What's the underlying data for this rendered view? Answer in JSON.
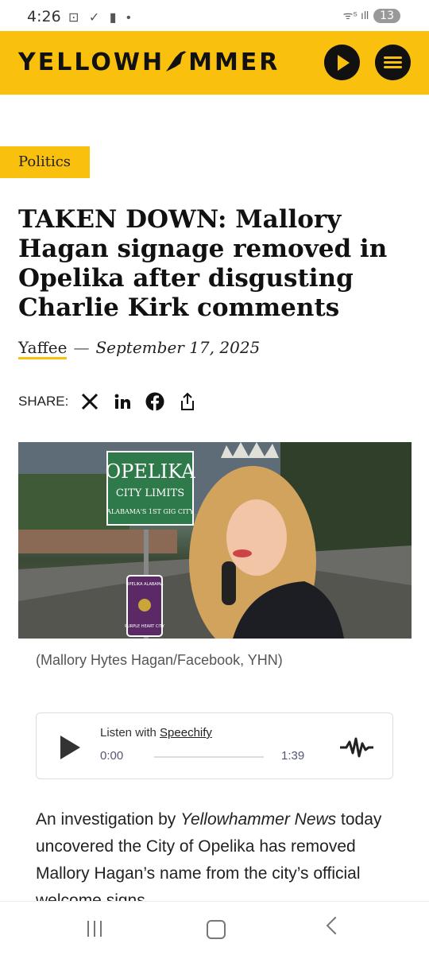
{
  "status_bar": {
    "time": "4:26",
    "icons": "⊡ ✓ ▮ •",
    "signal": "ᯤ⁵ ıll",
    "battery": "13"
  },
  "header": {
    "logo": "YELLOWHAMMER",
    "logo_left": "YELLOWH",
    "logo_right": "MMER"
  },
  "article": {
    "category": "Politics",
    "headline": "TAKEN DOWN: Mallory Hagan signage removed in Opelika after disgusting Charlie Kirk comments",
    "author": "Yaffee",
    "separator": "—",
    "date": "September 17, 2025",
    "share_label": "SHARE:",
    "image_sign_title": "OPELIKA",
    "image_sign_sub": "CITY LIMITS",
    "image_sign_line": "ALABAMA'S 1ST GIG CITY",
    "image_small_sign_top": "OPELIKA ALABAMA",
    "image_small_sign_bottom": "PURPLE HEART CITY",
    "caption": "(Mallory Hytes Hagan/Facebook, YHN)",
    "body_prefix": "An investigation by ",
    "body_italic": "Yellowhammer News",
    "body_rest": " today uncovered the City of Opelika has removed Mallory Hagan’s name from the city’s official welcome signs."
  },
  "player": {
    "label_prefix": "Listen with ",
    "label_link": "Speechify",
    "current_time": "0:00",
    "duration": "1:39"
  },
  "colors": {
    "brand_yellow": "#f9c10e",
    "dark": "#111111"
  }
}
